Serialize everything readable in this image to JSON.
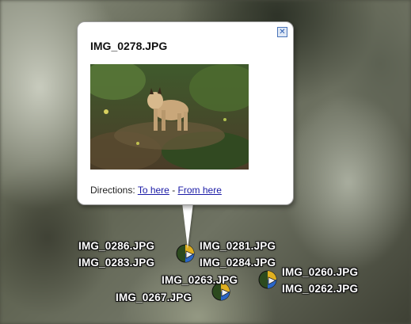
{
  "balloon": {
    "title": "IMG_0278.JPG",
    "directions_prefix": "Directions:",
    "to_here": "To here",
    "separator": "-",
    "from_here": "From here",
    "close_symbol": "✕"
  },
  "placemarks": [
    {
      "label": "IMG_0286.JPG"
    },
    {
      "label": "IMG_0281.JPG"
    },
    {
      "label": "IMG_0283.JPG"
    },
    {
      "label": "IMG_0284.JPG"
    },
    {
      "label": "IMG_0263.JPG"
    },
    {
      "label": "IMG_0260.JPG"
    },
    {
      "label": "IMG_0262.JPG"
    },
    {
      "label": "IMG_0267.JPG"
    }
  ],
  "icons": {
    "placemark": "photo-placemark-icon",
    "close": "close-icon"
  },
  "colors": {
    "link": "#1a1aa6",
    "label_text": "#ffffff"
  }
}
